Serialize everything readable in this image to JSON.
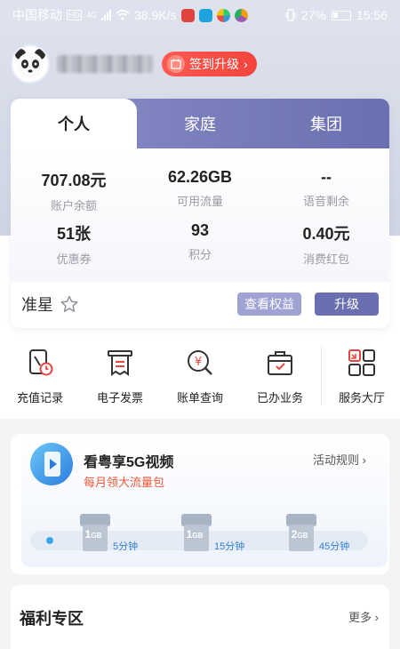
{
  "status_bar": {
    "carrier": "中国移动",
    "hd": "HD",
    "net": "4G",
    "speed": "38.9K/s",
    "battery": "27%",
    "time": "15:56"
  },
  "profile": {
    "signin_label": "签到升级"
  },
  "tabs": [
    "个人",
    "家庭",
    "集团"
  ],
  "stats": [
    {
      "value": "707.08元",
      "label": "账户余额"
    },
    {
      "value": "62.26GB",
      "label": "可用流量"
    },
    {
      "value": "--",
      "label": "语音剩余"
    },
    {
      "value": "51张",
      "label": "优惠券"
    },
    {
      "value": "93",
      "label": "积分"
    },
    {
      "value": "0.40元",
      "label": "消费红包"
    }
  ],
  "level": {
    "name": "准星"
  },
  "buttons": {
    "rights": "查看权益",
    "upgrade": "升级"
  },
  "quick_actions": [
    {
      "label": "充值记录",
      "icon": "recharge-record-icon"
    },
    {
      "label": "电子发票",
      "icon": "invoice-icon"
    },
    {
      "label": "账单查询",
      "icon": "bill-query-icon"
    },
    {
      "label": "已办业务",
      "icon": "handled-business-icon"
    },
    {
      "label": "服务大厅",
      "icon": "service-hall-icon"
    }
  ],
  "promo": {
    "title": "看粤享5G视频",
    "subtitle": "每月领大流量包",
    "rule": "活动规则",
    "gifts": [
      {
        "size": "1",
        "unit": "GB",
        "minutes": "5分钟"
      },
      {
        "size": "1",
        "unit": "GB",
        "minutes": "15分钟"
      },
      {
        "size": "2",
        "unit": "GB",
        "minutes": "45分钟"
      }
    ]
  },
  "welfare": {
    "title": "福利专区",
    "more": "更多"
  },
  "colors": {
    "primary": "#6a6fb0",
    "accent_red": "#f2453d",
    "promo_orange": "#f05a3b",
    "link_blue": "#2f7fd4"
  }
}
